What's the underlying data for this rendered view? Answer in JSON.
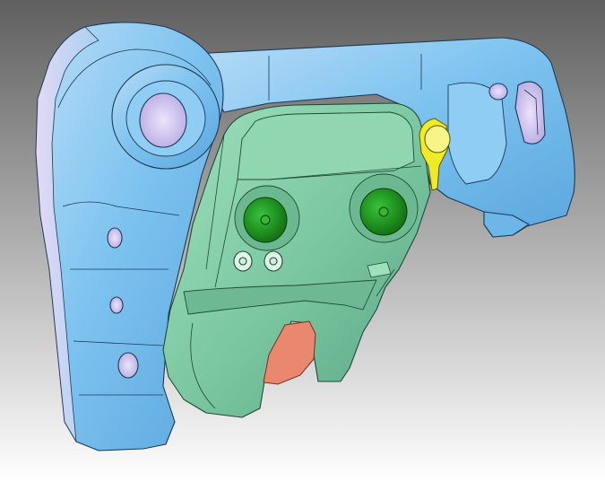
{
  "viewport": {
    "background_top": "#5f5f5f",
    "background_bottom": "#ffffff"
  },
  "model": {
    "parts": [
      {
        "name": "bracket",
        "color": "#7fc4f0"
      },
      {
        "name": "housing",
        "color": "#7cc8a2"
      },
      {
        "name": "buttons",
        "color": "#2a9a2a"
      },
      {
        "name": "latch-pin",
        "color": "#f3ef2e"
      },
      {
        "name": "pawl",
        "color": "#e9876f"
      }
    ]
  }
}
